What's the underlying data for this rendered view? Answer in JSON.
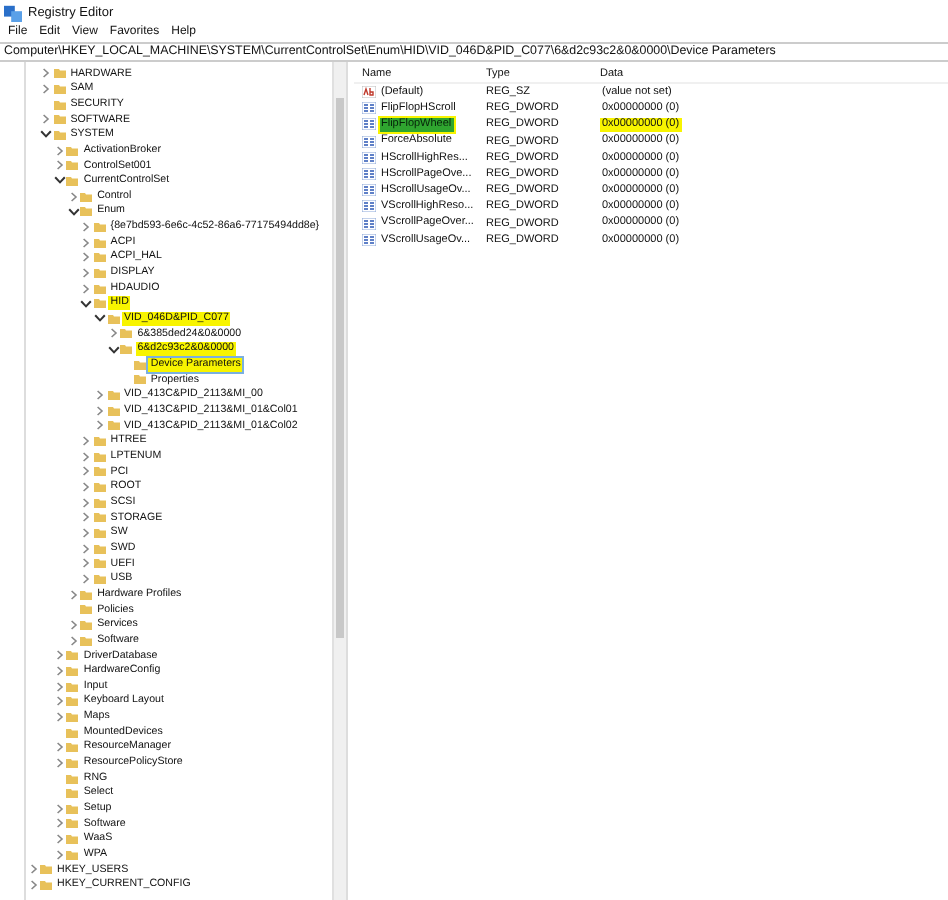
{
  "window": {
    "title": "Registry Editor"
  },
  "menu": [
    {
      "label": "File"
    },
    {
      "label": "Edit"
    },
    {
      "label": "View"
    },
    {
      "label": "Favorites"
    },
    {
      "label": "Help"
    }
  ],
  "address": "Computer\\HKEY_LOCAL_MACHINE\\SYSTEM\\CurrentControlSet\\Enum\\HID\\VID_046D&PID_C077\\6&d2c93c2&0&0000\\Device Parameters",
  "tree": {
    "items": [
      {
        "label": "HARDWARE",
        "expandable": true,
        "expanded": false,
        "highlighted": false,
        "selected": false
      },
      {
        "label": "SAM",
        "expandable": true,
        "expanded": false,
        "highlighted": false,
        "selected": false
      },
      {
        "label": "SECURITY",
        "expandable": false,
        "highlighted": false,
        "selected": false
      },
      {
        "label": "SOFTWARE",
        "expandable": true,
        "expanded": false,
        "highlighted": false,
        "selected": false
      },
      {
        "label": "SYSTEM",
        "expandable": true,
        "expanded": true,
        "highlighted": false,
        "selected": false,
        "children": [
          {
            "label": "ActivationBroker",
            "expandable": true,
            "expanded": false,
            "highlighted": false,
            "selected": false
          },
          {
            "label": "ControlSet001",
            "expandable": true,
            "expanded": false,
            "highlighted": false,
            "selected": false
          },
          {
            "label": "CurrentControlSet",
            "expandable": true,
            "expanded": true,
            "highlighted": false,
            "selected": false,
            "children": [
              {
                "label": "Control",
                "expandable": true,
                "expanded": false,
                "highlighted": false,
                "selected": false
              },
              {
                "label": "Enum",
                "expandable": true,
                "expanded": true,
                "highlighted": false,
                "selected": false,
                "children": [
                  {
                    "label": "{8e7bd593-6e6c-4c52-86a6-77175494dd8e}",
                    "expandable": true,
                    "expanded": false,
                    "highlighted": false,
                    "selected": false
                  },
                  {
                    "label": "ACPI",
                    "expandable": true,
                    "expanded": false,
                    "highlighted": false,
                    "selected": false
                  },
                  {
                    "label": "ACPI_HAL",
                    "expandable": true,
                    "expanded": false,
                    "highlighted": false,
                    "selected": false
                  },
                  {
                    "label": "DISPLAY",
                    "expandable": true,
                    "expanded": false,
                    "highlighted": false,
                    "selected": false
                  },
                  {
                    "label": "HDAUDIO",
                    "expandable": true,
                    "expanded": false,
                    "highlighted": false,
                    "selected": false
                  },
                  {
                    "label": "HID",
                    "expandable": true,
                    "expanded": true,
                    "highlighted": true,
                    "selected": false,
                    "children": [
                      {
                        "label": "VID_046D&PID_C077",
                        "expandable": true,
                        "expanded": true,
                        "highlighted": true,
                        "selected": false,
                        "children": [
                          {
                            "label": "6&385ded24&0&0000",
                            "expandable": true,
                            "expanded": false,
                            "highlighted": false,
                            "selected": false
                          },
                          {
                            "label": "6&d2c93c2&0&0000",
                            "expandable": true,
                            "expanded": true,
                            "highlighted": true,
                            "selected": false,
                            "children": [
                              {
                                "label": "Device Parameters",
                                "expandable": false,
                                "highlighted": true,
                                "selected": true
                              },
                              {
                                "label": "Properties",
                                "expandable": false,
                                "highlighted": false,
                                "selected": false
                              }
                            ]
                          }
                        ]
                      },
                      {
                        "label": "VID_413C&PID_2113&MI_00",
                        "expandable": true,
                        "expanded": false,
                        "highlighted": false,
                        "selected": false
                      },
                      {
                        "label": "VID_413C&PID_2113&MI_01&Col01",
                        "expandable": true,
                        "expanded": false,
                        "highlighted": false,
                        "selected": false
                      },
                      {
                        "label": "VID_413C&PID_2113&MI_01&Col02",
                        "expandable": true,
                        "expanded": false,
                        "highlighted": false,
                        "selected": false
                      }
                    ]
                  },
                  {
                    "label": "HTREE",
                    "expandable": true,
                    "expanded": false,
                    "highlighted": false,
                    "selected": false
                  },
                  {
                    "label": "LPTENUM",
                    "expandable": true,
                    "expanded": false,
                    "highlighted": false,
                    "selected": false
                  },
                  {
                    "label": "PCI",
                    "expandable": true,
                    "expanded": false,
                    "highlighted": false,
                    "selected": false
                  },
                  {
                    "label": "ROOT",
                    "expandable": true,
                    "expanded": false,
                    "highlighted": false,
                    "selected": false
                  },
                  {
                    "label": "SCSI",
                    "expandable": true,
                    "expanded": false,
                    "highlighted": false,
                    "selected": false
                  },
                  {
                    "label": "STORAGE",
                    "expandable": true,
                    "expanded": false,
                    "highlighted": false,
                    "selected": false
                  },
                  {
                    "label": "SW",
                    "expandable": true,
                    "expanded": false,
                    "highlighted": false,
                    "selected": false
                  },
                  {
                    "label": "SWD",
                    "expandable": true,
                    "expanded": false,
                    "highlighted": false,
                    "selected": false
                  },
                  {
                    "label": "UEFI",
                    "expandable": true,
                    "expanded": false,
                    "highlighted": false,
                    "selected": false
                  },
                  {
                    "label": "USB",
                    "expandable": true,
                    "expanded": false,
                    "highlighted": false,
                    "selected": false
                  }
                ]
              },
              {
                "label": "Hardware Profiles",
                "expandable": true,
                "expanded": false,
                "highlighted": false,
                "selected": false
              },
              {
                "label": "Policies",
                "expandable": false,
                "highlighted": false,
                "selected": false
              },
              {
                "label": "Services",
                "expandable": true,
                "expanded": false,
                "highlighted": false,
                "selected": false
              },
              {
                "label": "Software",
                "expandable": true,
                "expanded": false,
                "highlighted": false,
                "selected": false
              }
            ]
          },
          {
            "label": "DriverDatabase",
            "expandable": true,
            "expanded": false,
            "highlighted": false,
            "selected": false
          },
          {
            "label": "HardwareConfig",
            "expandable": true,
            "expanded": false,
            "highlighted": false,
            "selected": false
          },
          {
            "label": "Input",
            "expandable": true,
            "expanded": false,
            "highlighted": false,
            "selected": false
          },
          {
            "label": "Keyboard Layout",
            "expandable": true,
            "expanded": false,
            "highlighted": false,
            "selected": false
          },
          {
            "label": "Maps",
            "expandable": true,
            "expanded": false,
            "highlighted": false,
            "selected": false
          },
          {
            "label": "MountedDevices",
            "expandable": false,
            "highlighted": false,
            "selected": false
          },
          {
            "label": "ResourceManager",
            "expandable": true,
            "expanded": false,
            "highlighted": false,
            "selected": false
          },
          {
            "label": "ResourcePolicyStore",
            "expandable": true,
            "expanded": false,
            "highlighted": false,
            "selected": false
          },
          {
            "label": "RNG",
            "expandable": false,
            "highlighted": false,
            "selected": false
          },
          {
            "label": "Select",
            "expandable": false,
            "highlighted": false,
            "selected": false
          },
          {
            "label": "Setup",
            "expandable": true,
            "expanded": false,
            "highlighted": false,
            "selected": false
          },
          {
            "label": "Software",
            "expandable": true,
            "expanded": false,
            "highlighted": false,
            "selected": false
          },
          {
            "label": "WaaS",
            "expandable": true,
            "expanded": false,
            "highlighted": false,
            "selected": false
          },
          {
            "label": "WPA",
            "expandable": true,
            "expanded": false,
            "highlighted": false,
            "selected": false
          }
        ]
      }
    ],
    "root_items": [
      {
        "label": "HKEY_USERS",
        "expandable": true,
        "expanded": false,
        "highlighted": false,
        "selected": false
      },
      {
        "label": "HKEY_CURRENT_CONFIG",
        "expandable": true,
        "expanded": false,
        "highlighted": false,
        "selected": false
      }
    ]
  },
  "values": {
    "columns": [
      "Name",
      "Type",
      "Data"
    ],
    "rows": [
      {
        "name": "(Default)",
        "type": "REG_SZ",
        "data": "(value not set)",
        "kind": "string",
        "selected": false,
        "highlighted": false,
        "data_highlighted": false
      },
      {
        "name": "FlipFlopHScroll",
        "type": "REG_DWORD",
        "data": "0x00000000 (0)",
        "kind": "dword",
        "selected": false,
        "highlighted": false,
        "data_highlighted": false
      },
      {
        "name": "FlipFlopWheel",
        "type": "REG_DWORD",
        "data": "0x00000000 (0)",
        "kind": "dword",
        "selected": true,
        "highlighted": true,
        "data_highlighted": true
      },
      {
        "name": "ForceAbsolute",
        "type": "REG_DWORD",
        "data": "0x00000000 (0)",
        "kind": "dword",
        "selected": false,
        "highlighted": false,
        "data_highlighted": false
      },
      {
        "name": "HScrollHighRes...",
        "type": "REG_DWORD",
        "data": "0x00000000 (0)",
        "kind": "dword",
        "selected": false,
        "highlighted": false,
        "data_highlighted": false
      },
      {
        "name": "HScrollPageOve...",
        "type": "REG_DWORD",
        "data": "0x00000000 (0)",
        "kind": "dword",
        "selected": false,
        "highlighted": false,
        "data_highlighted": false
      },
      {
        "name": "HScrollUsageOv...",
        "type": "REG_DWORD",
        "data": "0x00000000 (0)",
        "kind": "dword",
        "selected": false,
        "highlighted": false,
        "data_highlighted": false
      },
      {
        "name": "VScrollHighReso...",
        "type": "REG_DWORD",
        "data": "0x00000000 (0)",
        "kind": "dword",
        "selected": false,
        "highlighted": false,
        "data_highlighted": false
      },
      {
        "name": "VScrollPageOver...",
        "type": "REG_DWORD",
        "data": "0x00000000 (0)",
        "kind": "dword",
        "selected": false,
        "highlighted": false,
        "data_highlighted": false
      },
      {
        "name": "VScrollUsageOv...",
        "type": "REG_DWORD",
        "data": "0x00000000 (0)",
        "kind": "dword",
        "selected": false,
        "highlighted": false,
        "data_highlighted": false
      }
    ]
  }
}
